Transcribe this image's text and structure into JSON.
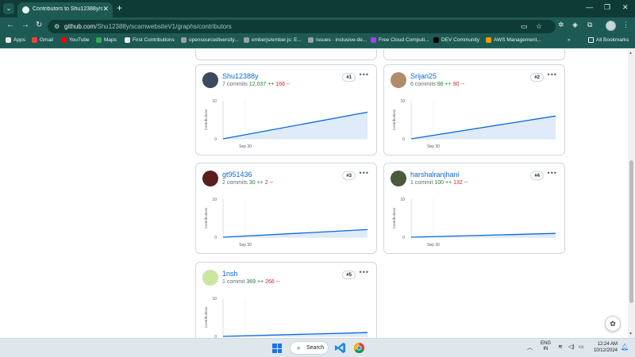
{
  "browser": {
    "tab_title": "Contributors to Shu12388y/sca",
    "url_host": "github.com",
    "url_path": "/Shu12388y/scamwebsiteV1/graphs/contributors",
    "bookmarks": [
      {
        "label": "Apps",
        "color": "#e8eaed"
      },
      {
        "label": "Gmail",
        "color": "#ea4335"
      },
      {
        "label": "YouTube",
        "color": "#ff0000"
      },
      {
        "label": "Maps",
        "color": "#34a853"
      },
      {
        "label": "First Contributions",
        "color": "#e8eaed"
      },
      {
        "label": "opensourcediversity...",
        "color": "#9aa0a6"
      },
      {
        "label": "emberjs/ember.js: E...",
        "color": "#9aa0a6"
      },
      {
        "label": "Issues · inclusive-de...",
        "color": "#9aa0a6"
      },
      {
        "label": "Free Cloud Computi...",
        "color": "#a142f4"
      },
      {
        "label": "DEV Community",
        "color": "#000000"
      },
      {
        "label": "AWS Management...",
        "color": "#ff9900"
      }
    ],
    "all_bookmarks": "All Bookmarks",
    "chevron": "»"
  },
  "contributors": [
    {
      "name": "Shu12388y",
      "commits": "7 commits",
      "additions": "12,037 ++",
      "deletions": "166 --",
      "rank": "#1",
      "avatar_color": "#3b4a5c",
      "chart_data": {
        "type": "area",
        "x": [
          "Sep 30",
          "end"
        ],
        "values": [
          0,
          7
        ],
        "ylim": [
          0,
          10
        ],
        "yticks": [
          0,
          10
        ],
        "ylabel": "Contributions",
        "xtick": "Sep 30"
      }
    },
    {
      "name": "Srijan25",
      "commits": "6 commits",
      "additions": "98 ++",
      "deletions": "90 --",
      "rank": "#2",
      "avatar_color": "#b08d6a",
      "chart_data": {
        "type": "area",
        "x": [
          "Sep 30",
          "end"
        ],
        "values": [
          0,
          6
        ],
        "ylim": [
          0,
          10
        ],
        "yticks": [
          0,
          10
        ],
        "ylabel": "Contributions",
        "xtick": "Sep 30"
      }
    },
    {
      "name": "gt951436",
      "commits": "2 commits",
      "additions": "30 ++",
      "deletions": "2 --",
      "rank": "#3",
      "avatar_color": "#5a1e1e",
      "chart_data": {
        "type": "area",
        "x": [
          "Sep 30",
          "end"
        ],
        "values": [
          0,
          2
        ],
        "ylim": [
          0,
          10
        ],
        "yticks": [
          0,
          10
        ],
        "ylabel": "Contributions",
        "xtick": "Sep 30"
      }
    },
    {
      "name": "harshalranjhani",
      "commits": "1 commit",
      "additions": "100 ++",
      "deletions": "132 --",
      "rank": "#4",
      "avatar_color": "#4a5a3a",
      "chart_data": {
        "type": "area",
        "x": [
          "Sep 30",
          "end"
        ],
        "values": [
          0,
          1
        ],
        "ylim": [
          0,
          10
        ],
        "yticks": [
          0,
          10
        ],
        "ylabel": "Contributions",
        "xtick": "Sep 30"
      }
    },
    {
      "name": "1nsh",
      "commits": "1 commit",
      "additions": "369 ++",
      "deletions": "266 --",
      "rank": "#5",
      "avatar_color": "#c8e6a0",
      "chart_data": {
        "type": "area",
        "x": [
          "Sep 30",
          "end"
        ],
        "values": [
          0,
          1
        ],
        "ylim": [
          0,
          10
        ],
        "yticks": [
          0,
          10
        ],
        "ylabel": "Contributions",
        "xtick": "Sep 30"
      }
    }
  ],
  "taskbar": {
    "search_label": "Search",
    "lang_line1": "ENG",
    "lang_line2": "IN",
    "time": "12:24 AM",
    "date": "10/12/2024"
  },
  "colors": {
    "accent": "#0969da",
    "line": "#0969da",
    "area_fill": "#dbe9f8",
    "chrome_dark": "#0f3b37",
    "chrome": "#1e5a54"
  }
}
